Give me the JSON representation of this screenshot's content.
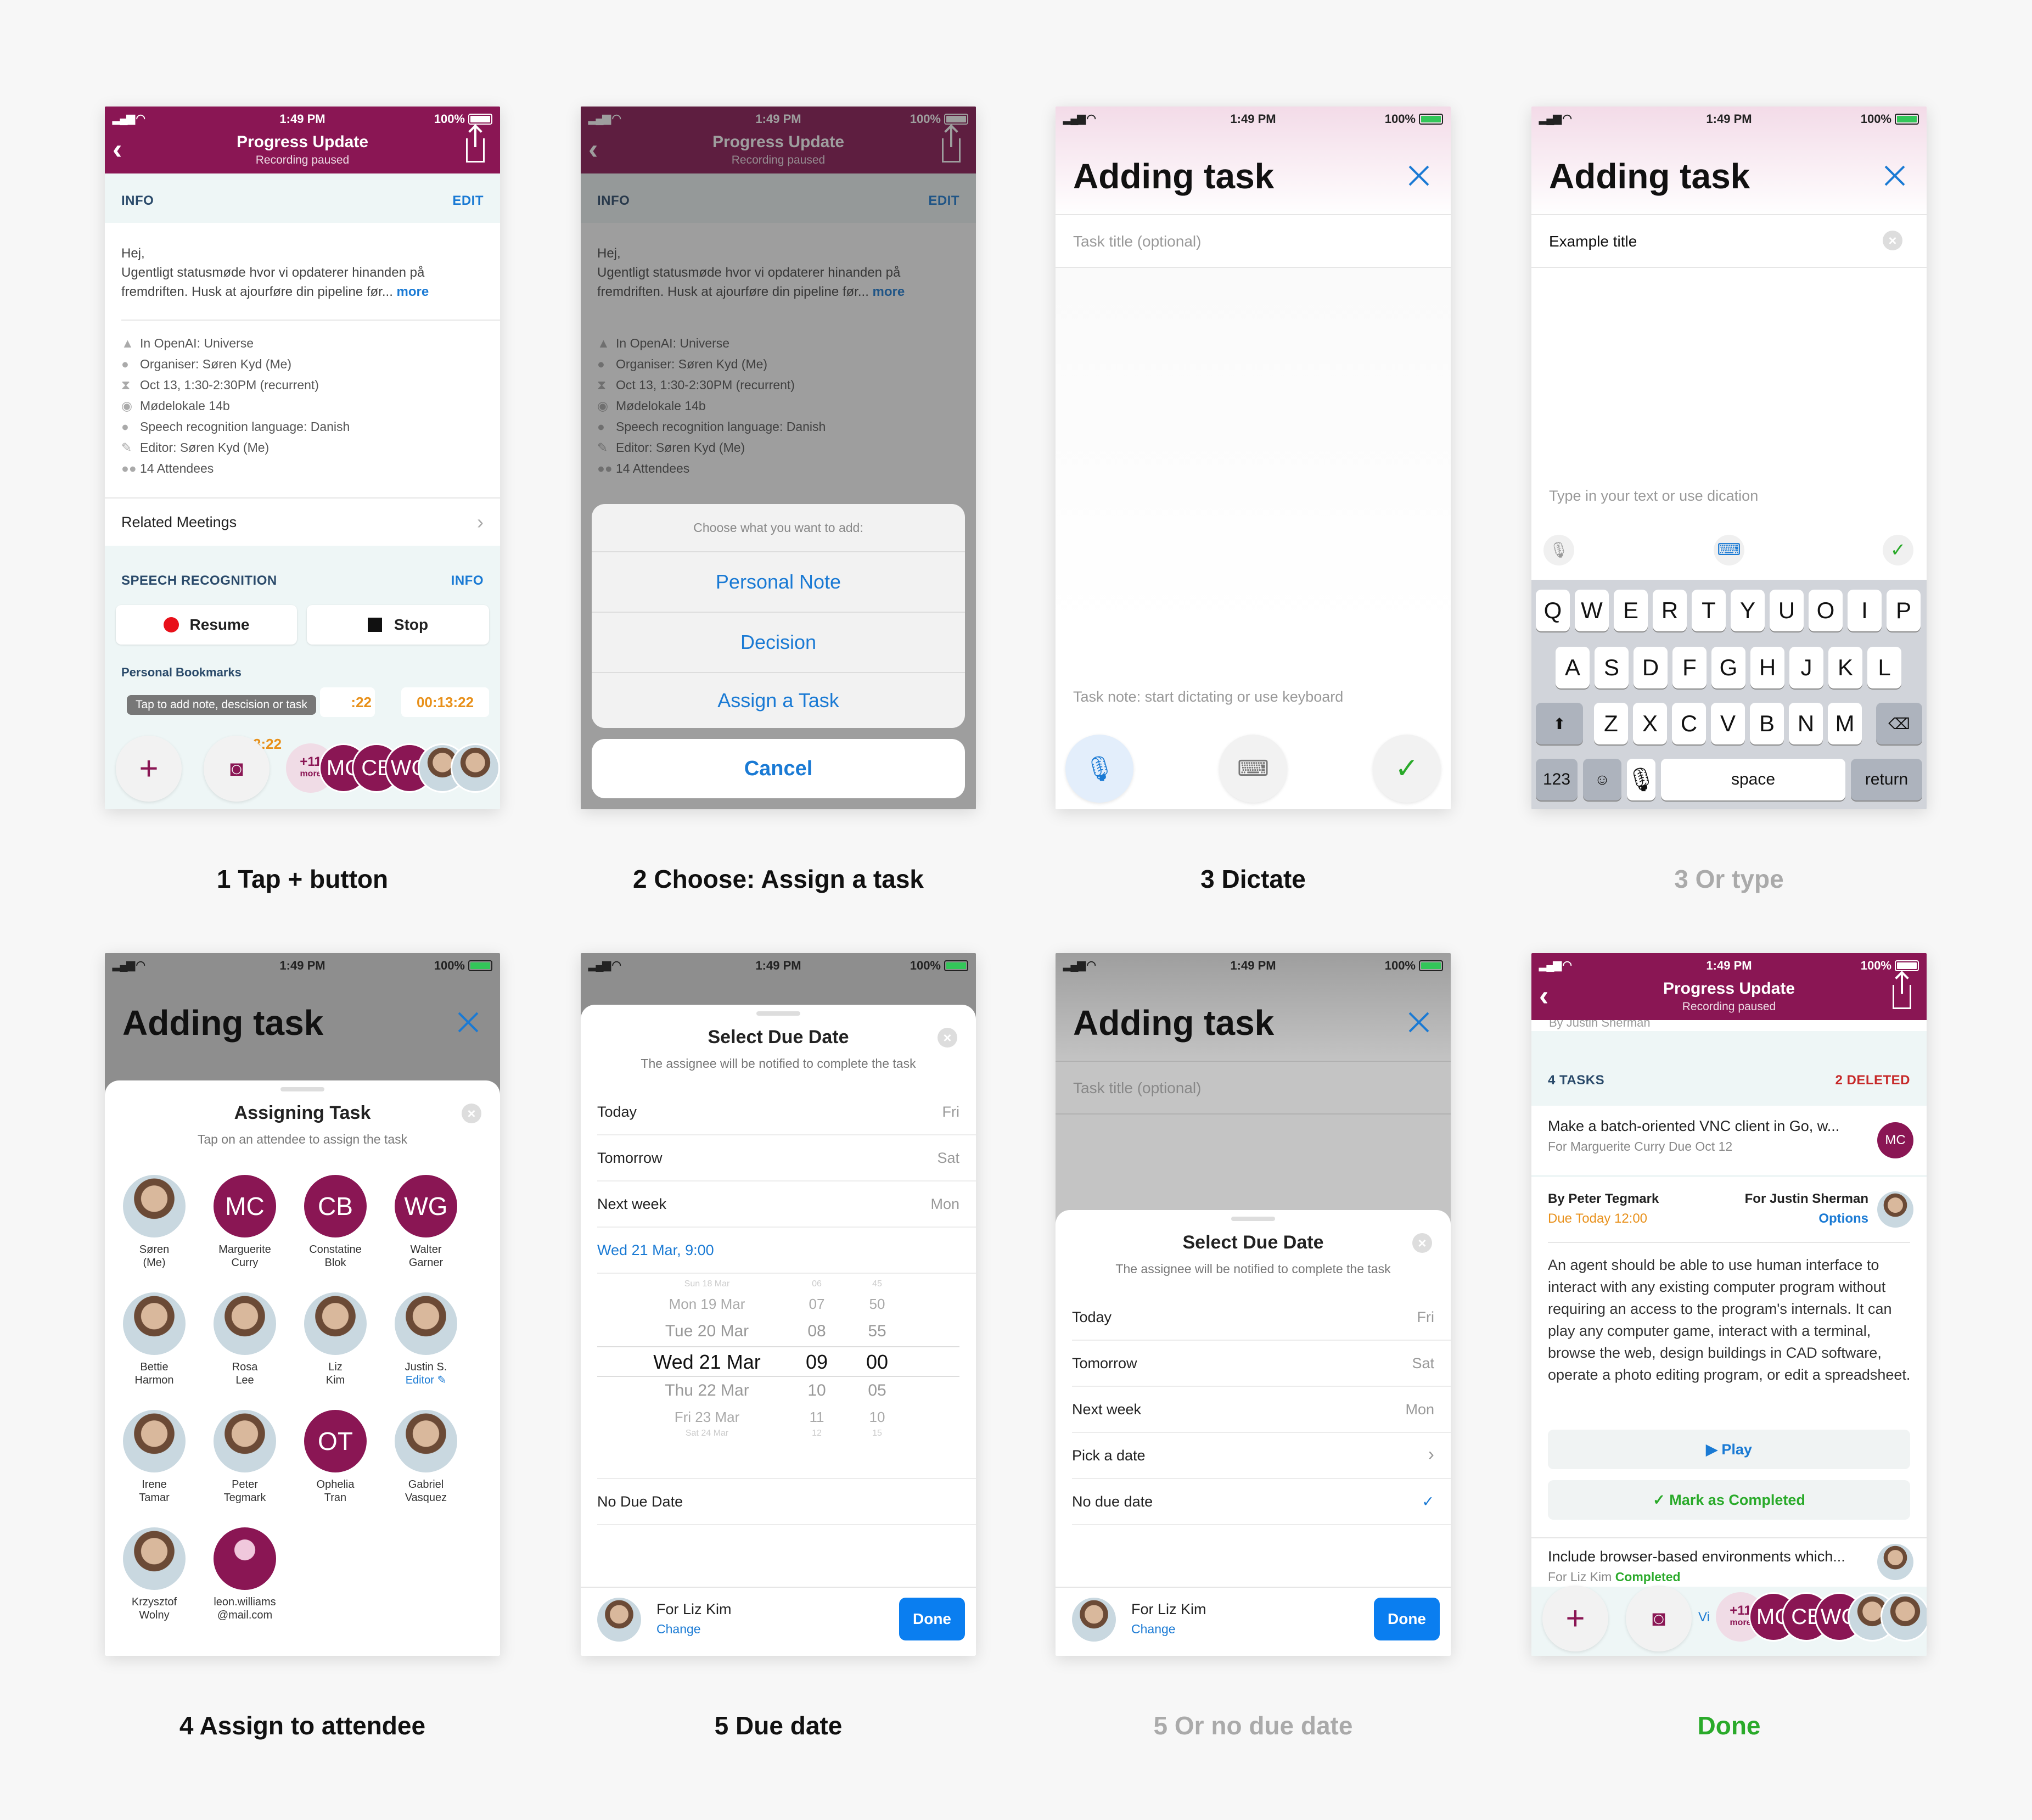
{
  "status": {
    "time": "1:49 PM",
    "battery": "100%"
  },
  "meeting": {
    "title": "Progress Update",
    "subtitle": "Recording paused",
    "info_label": "INFO",
    "edit_label": "EDIT",
    "description": "Hej,\nUgentligt statusmøde hvor vi opdaterer hinanden på fremdriften. Husk at ajourføre din pipeline før...",
    "more_label": "more",
    "details": [
      "In OpenAI: Universe",
      "Organiser: Søren Kyd (Me)",
      "Oct 13, 1:30-2:30PM (recurrent)",
      "Mødelokale 14b",
      "Speech recognition language: Danish",
      "Editor: Søren Kyd (Me)",
      "14 Attendees"
    ],
    "related": "Related Meetings",
    "speech_label": "SPEECH RECOGNITION",
    "speech_info": "INFO",
    "resume": "Resume",
    "stop": "Stop",
    "bookmarks_label": "Personal Bookmarks",
    "tooltip": "Tap to add note, descision or task",
    "bm1": ":22",
    "bm2": "00:13:22",
    "bm3": "22",
    "bm4": "3:22",
    "more_count": "+11",
    "more_word": "more",
    "initials": [
      "MC",
      "CB",
      "WG"
    ]
  },
  "actionsheet": {
    "header": "Choose what you want to add:",
    "options": [
      "Personal Note",
      "Decision",
      "Assign a Task"
    ],
    "cancel": "Cancel"
  },
  "adding": {
    "title": "Adding task",
    "title_placeholder": "Task title (optional)",
    "note_placeholder": "Task note: start dictating or use keyboard",
    "typed_title": "Example title",
    "type_placeholder": "Type in your text or use dication"
  },
  "keyboard": {
    "row1": [
      "Q",
      "W",
      "E",
      "R",
      "T",
      "Y",
      "U",
      "O",
      "I",
      "P"
    ],
    "row2": [
      "A",
      "S",
      "D",
      "F",
      "G",
      "H",
      "J",
      "K",
      "L"
    ],
    "row3": [
      "Z",
      "X",
      "C",
      "V",
      "B",
      "N",
      "M"
    ],
    "num": "123",
    "space": "space",
    "ret": "return"
  },
  "assign": {
    "title": "Assigning Task",
    "subtitle": "Tap on an attendee to assign the task",
    "people": [
      {
        "name": "Søren\n(Me)",
        "initials": "",
        "photo": true
      },
      {
        "name": "Marguerite\nCurry",
        "initials": "MC",
        "photo": false
      },
      {
        "name": "Constatine\nBlok",
        "initials": "CB",
        "photo": false
      },
      {
        "name": "Walter\nGarner",
        "initials": "WG",
        "photo": false
      },
      {
        "name": "Bettie\nHarmon",
        "initials": "",
        "photo": true
      },
      {
        "name": "Rosa\nLee",
        "initials": "",
        "photo": true
      },
      {
        "name": "Liz\nKim",
        "initials": "",
        "photo": true
      },
      {
        "name": "Justin S.",
        "initials": "",
        "photo": true,
        "extra": "Editor ✎"
      },
      {
        "name": "Irene\nTamar",
        "initials": "",
        "photo": true
      },
      {
        "name": "Peter\nTegmark",
        "initials": "",
        "photo": true
      },
      {
        "name": "Ophelia\nTran",
        "initials": "OT",
        "photo": false
      },
      {
        "name": "Gabriel\nVasquez",
        "initials": "",
        "photo": true
      },
      {
        "name": "Krzysztof\nWolny",
        "initials": "",
        "photo": true
      },
      {
        "name": "leon.williams\n@mail.com",
        "initials": "",
        "photo": false,
        "generic": true
      }
    ]
  },
  "due": {
    "title": "Select Due Date",
    "subtitle": "The assignee will be notified to complete the task",
    "rows": [
      {
        "l": "Today",
        "r": "Fri"
      },
      {
        "l": "Tomorrow",
        "r": "Sat"
      },
      {
        "l": "Next week",
        "r": "Mon"
      }
    ],
    "selected": "Wed 21 Mar, 9:00",
    "picker_days": [
      "Sun 18 Mar",
      "Mon 19 Mar",
      "Tue 20 Mar",
      "Wed 21 Mar",
      "Thu 22 Mar",
      "Fri 23 Mar",
      "Sat 24 Mar"
    ],
    "picker_hours": [
      "06",
      "07",
      "08",
      "09",
      "10",
      "11",
      "12"
    ],
    "picker_mins": [
      "45",
      "50",
      "55",
      "00",
      "05",
      "10",
      "15"
    ],
    "no_due": "No Due Date",
    "pick": "Pick a date",
    "no_due2": "No due date",
    "for": "For Liz Kim",
    "change": "Change",
    "done": "Done"
  },
  "final": {
    "partial": "By Justin Sherman",
    "tasks_label": "4 TASKS",
    "deleted": "2 DELETED",
    "t1": "Make a batch-oriented VNC client in Go, w...",
    "t1sub": "For Marguerite Curry  Due Oct 12",
    "t1init": "MC",
    "by": "By Peter Tegmark",
    "for": "For Justin Sherman",
    "due_today": "Due Today 12:00",
    "options": "Options",
    "body": "An agent should be able to use human interface to interact with any existing computer program without requiring an access to the program's internals. It can play any computer game, interact with a terminal, browse the web, design buildings in CAD software, operate a photo editing program, or edit a spreadsheet.",
    "play": "▶ Play",
    "complete": "✓ Mark as Completed",
    "t2": "Include browser-based environments which...",
    "t2for": "For Liz Kim",
    "t2status": "Completed",
    "vi": "Vi"
  },
  "captions": [
    "1 Tap + button",
    "2 Choose: Assign a  task",
    "3 Dictate",
    "3 Or type",
    "4 Assign to attendee",
    "5 Due date",
    "5 Or no due date",
    "Done"
  ],
  "colors": {
    "brand": "#8a1654",
    "link": "#1a7ad4",
    "done_green": "#2aaa2a",
    "orange": "#e8901a"
  }
}
